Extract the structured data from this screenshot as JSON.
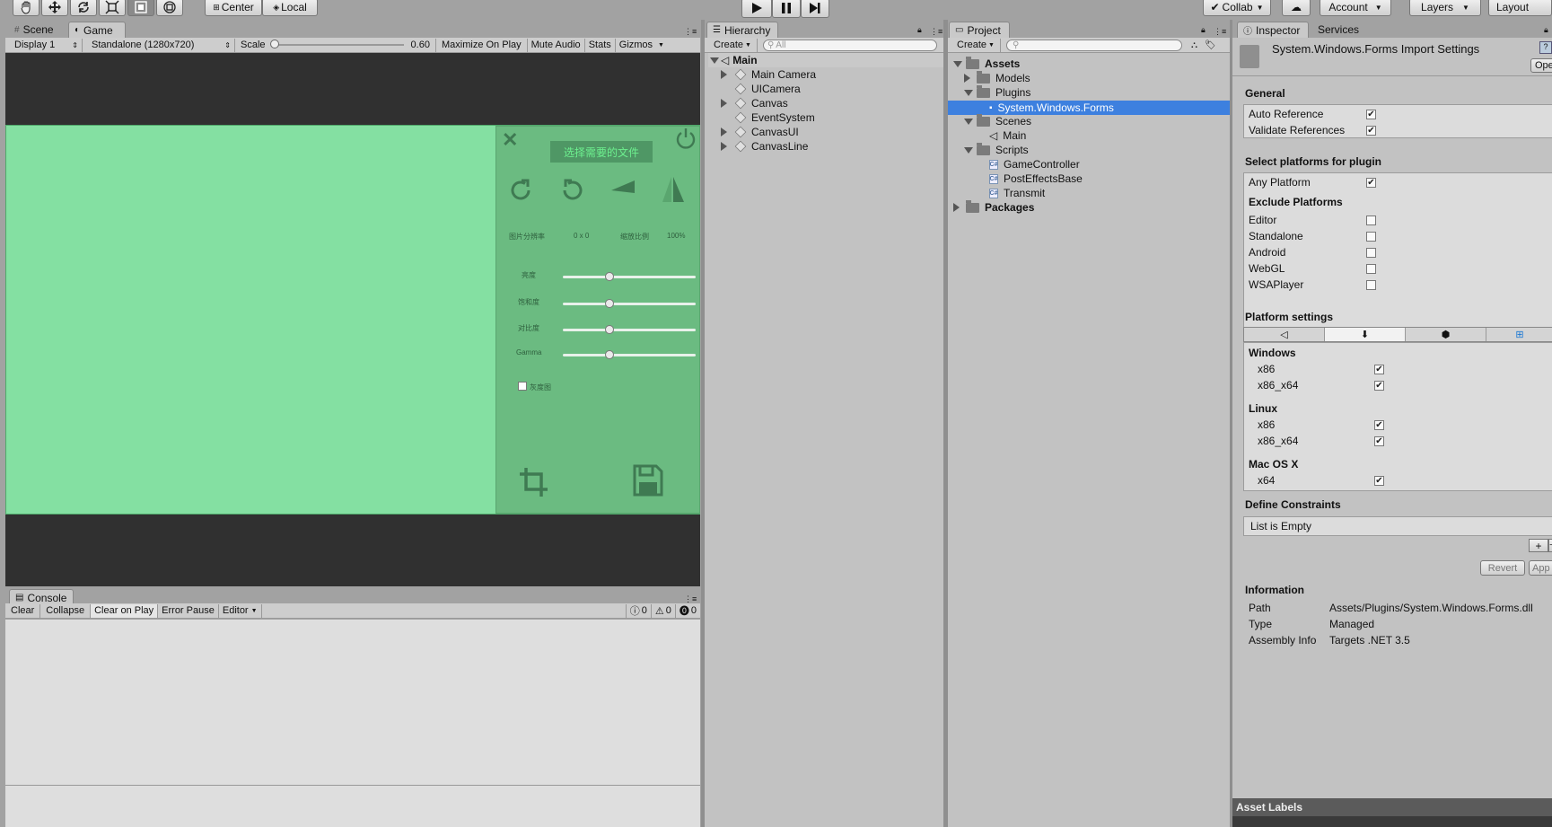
{
  "toolbar": {
    "pivot_label": "Center",
    "space_label": "Local",
    "collab_label": "Collab",
    "account_label": "Account",
    "layers_label": "Layers",
    "layout_label": "Layout"
  },
  "game_panel": {
    "tab_scene": "Scene",
    "tab_game": "Game",
    "display": "Display 1",
    "resolution": "Standalone (1280x720)",
    "scale_label": "Scale",
    "scale_value": "0.60",
    "maximize_label": "Maximize On Play",
    "mute_label": "Mute Audio",
    "stats_label": "Stats",
    "gizmos_label": "Gizmos",
    "ui": {
      "select_file_btn": "选择需要的文件",
      "resolution_label": "图片分辨率",
      "resolution_value": "0 x 0",
      "zoom_label": "缩放比例",
      "zoom_value": "100%",
      "brightness_label": "亮度",
      "saturation_label": "饱和度",
      "contrast_label": "对比度",
      "gamma_label": "Gamma",
      "grayscale_label": "灰度图",
      "sliders": {
        "brightness": 0.35,
        "saturation": 0.35,
        "contrast": 0.35,
        "gamma": 0.35
      }
    }
  },
  "console": {
    "tab": "Console",
    "clear": "Clear",
    "collapse": "Collapse",
    "clear_on_play": "Clear on Play",
    "error_pause": "Error Pause",
    "editor": "Editor",
    "info_count": "0",
    "warn_count": "0",
    "error_count": "0"
  },
  "hierarchy": {
    "tab": "Hierarchy",
    "create": "Create",
    "search_placeholder": "All",
    "scene": "Main",
    "items": [
      "Main Camera",
      "UICamera",
      "Canvas",
      "EventSystem",
      "CanvasUI",
      "CanvasLine"
    ]
  },
  "project": {
    "tab": "Project",
    "create": "Create",
    "assets": "Assets",
    "models": "Models",
    "plugins": "Plugins",
    "selected": "System.Windows.Forms",
    "scenes": "Scenes",
    "scene_main": "Main",
    "scripts": "Scripts",
    "script_items": [
      "GameController",
      "PostEffectsBase",
      "Transmit"
    ],
    "packages": "Packages"
  },
  "inspector": {
    "tab": "Inspector",
    "tab_services": "Services",
    "title": "System.Windows.Forms Import Settings",
    "open_label": "Ope",
    "general": "General",
    "auto_reference": "Auto Reference",
    "validate_references": "Validate References",
    "select_platforms": "Select platforms for plugin",
    "any_platform": "Any Platform",
    "exclude_platforms": "Exclude Platforms",
    "exclude_items": [
      "Editor",
      "Standalone",
      "Android",
      "WebGL",
      "WSAPlayer"
    ],
    "platform_settings": "Platform settings",
    "windows": "Windows",
    "linux": "Linux",
    "mac": "Mac OS X",
    "x86": "x86",
    "x86_64": "x86_x64",
    "x64": "x64",
    "define_constraints": "Define Constraints",
    "list_empty": "List is Empty",
    "revert": "Revert",
    "apply": "App",
    "information": "Information",
    "path_label": "Path",
    "path_value": "Assets/Plugins/System.Windows.Forms.dll",
    "type_label": "Type",
    "type_value": "Managed",
    "assembly_label": "Assembly Info",
    "assembly_value": "Targets .NET 3.5",
    "asset_labels": "Asset Labels"
  },
  "colors": {
    "game_bg": "#84e0a2",
    "side_panel": "#6bbb81",
    "selection": "#3d80df"
  }
}
